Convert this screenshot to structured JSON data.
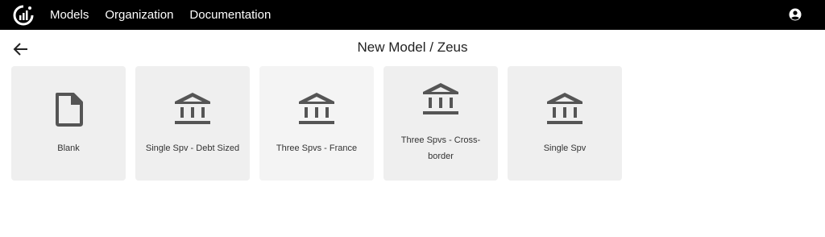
{
  "topbar": {
    "logo_icon": "analytics-logo-icon",
    "nav": [
      "Models",
      "Organization",
      "Documentation"
    ],
    "account_icon": "account-circle-icon"
  },
  "header": {
    "back_icon": "arrow-left-icon",
    "title": "New Model / Zeus"
  },
  "templates": [
    {
      "label": "Blank",
      "icon": "file-icon"
    },
    {
      "label": "Single Spv - Debt Sized",
      "icon": "bank-icon"
    },
    {
      "label": "Three Spvs - France",
      "icon": "bank-icon"
    },
    {
      "label": "Three Spvs - Cross-border",
      "icon": "bank-icon"
    },
    {
      "label": "Single Spv",
      "icon": "bank-icon"
    }
  ],
  "colors": {
    "topbar": "#000000",
    "card": "#efefef",
    "icon": "#555555"
  }
}
